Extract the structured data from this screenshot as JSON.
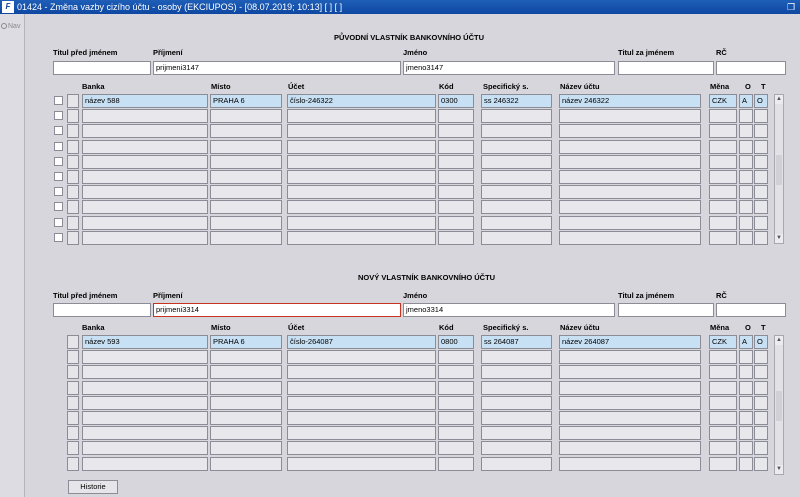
{
  "window": {
    "title": "01424 - Změna vazby cizího účtu - osoby (EKCIUPOS) - [08.07.2019; 10:13]  [ ]  [ ]",
    "app_icon": "forms-icon",
    "app_icon_glyph": "F"
  },
  "nav": {
    "label": "Nav"
  },
  "labels": {
    "titul_pred": "Titul před jménem",
    "prijmeni": "Příjmení",
    "jmeno": "Jméno",
    "titul_za": "Titul za jménem",
    "rc": "RČ",
    "banka": "Banka",
    "misto": "Místo",
    "ucet": "Účet",
    "kod": "Kód",
    "specificky": "Specifický s.",
    "nazev_uctu": "Název účtu",
    "mena": "Měna",
    "o": "O",
    "t": "T"
  },
  "original_owner": {
    "heading": "PŮVODNÍ VLASTNÍK BANKOVNÍHO ÚČTU",
    "titul_pred": "",
    "prijmeni": "prijmeni3147",
    "jmeno": "jmeno3147",
    "titul_za": "",
    "rc": "",
    "accounts": [
      {
        "banka": "název 588",
        "misto": "PRAHA 6",
        "ucet": "číslo-246322",
        "kod": "0300",
        "specificky": "ss 246322",
        "nazev": "název 246322",
        "mena": "CZK",
        "o": "A",
        "t": "O"
      }
    ]
  },
  "new_owner": {
    "heading": "NOVÝ VLASTNÍK BANKOVNÍHO ÚČTU",
    "titul_pred": "",
    "prijmeni": "prijmeni3314",
    "jmeno": "jmeno3314",
    "titul_za": "",
    "rc": "",
    "accounts": [
      {
        "banka": "název 593",
        "misto": "PRAHA 6",
        "ucet": "číslo-264087",
        "kod": "0800",
        "specificky": "ss 264087",
        "nazev": "název 264087",
        "mena": "CZK",
        "o": "A",
        "t": "O"
      }
    ]
  },
  "buttons": {
    "historie": "Historie"
  }
}
